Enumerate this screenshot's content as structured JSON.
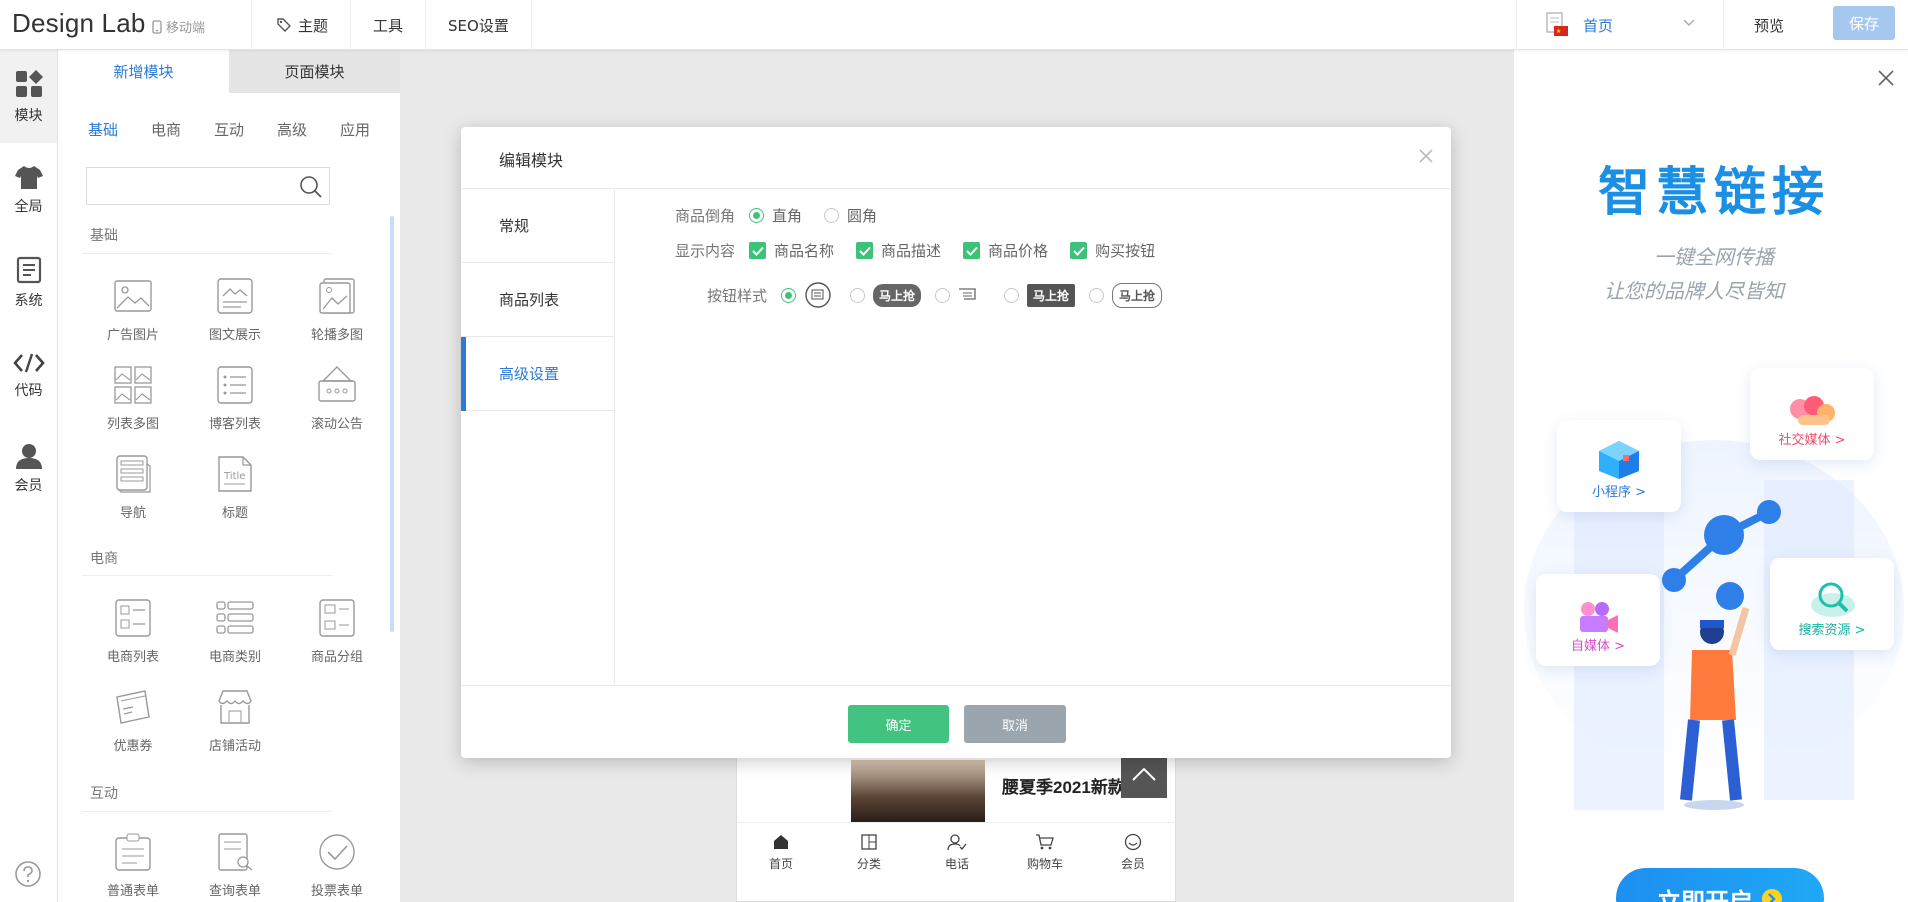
{
  "topbar": {
    "logo": "Design Lab",
    "mobile_label": "移动端",
    "nav": [
      "主题",
      "工具",
      "SEO设置"
    ],
    "page_select": "首页",
    "preview": "预览",
    "save": "保存"
  },
  "rail": {
    "items": [
      "模块",
      "全局",
      "系统",
      "代码",
      "会员"
    ]
  },
  "panel": {
    "tabs": [
      "新增模块",
      "页面模块"
    ],
    "categories": [
      "基础",
      "电商",
      "互动",
      "高级",
      "应用"
    ],
    "search_placeholder": "",
    "sections": [
      {
        "title": "基础",
        "items": [
          "广告图片",
          "图文展示",
          "轮播多图",
          "列表多图",
          "博客列表",
          "滚动公告",
          "导航",
          "标题"
        ]
      },
      {
        "title": "电商",
        "items": [
          "电商列表",
          "电商类别",
          "商品分组",
          "优惠券",
          "店铺活动"
        ]
      },
      {
        "title": "互动",
        "items": [
          "普通表单",
          "查询表单",
          "投票表单"
        ]
      }
    ]
  },
  "phone": {
    "product_text": [
      "腰夏季2021新款"
    ],
    "bottom_nav": [
      "首页",
      "分类",
      "电话",
      "购物车",
      "会员"
    ]
  },
  "ad": {
    "title": "智慧链接",
    "sub": [
      "一键全网传播",
      "让您的品牌人尽皆知"
    ],
    "cards": [
      "小程序 >",
      "社交媒体 >",
      "自媒体 >",
      "搜索资源 >"
    ],
    "button": "立即开启"
  },
  "modal": {
    "title": "编辑模块",
    "tabs": [
      "常规",
      "商品列表",
      "高级设置"
    ],
    "corner_label": "商品倒角",
    "corner_options": [
      "直角",
      "圆角"
    ],
    "content_label": "显示内容",
    "content_options": [
      "商品名称",
      "商品描述",
      "商品价格",
      "购买按钮"
    ],
    "button_style_label": "按钮样式",
    "button_tag": "马上抢",
    "ok": "确定",
    "cancel": "取消"
  },
  "colors": {
    "accent": "#2d7ad6",
    "green": "#42c37f",
    "save": "#a6c8ee"
  }
}
